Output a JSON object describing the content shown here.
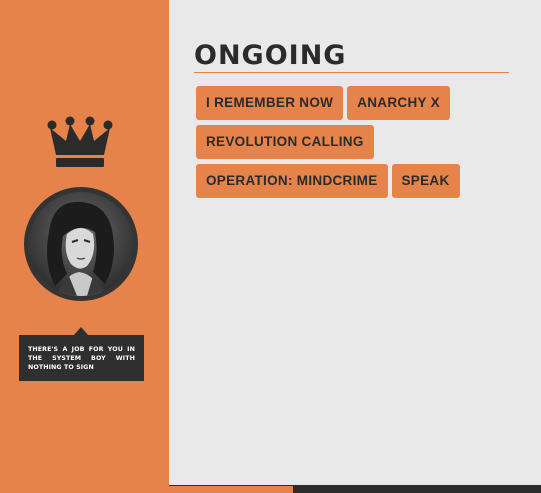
{
  "header": {
    "title": "ongoing"
  },
  "sidebar": {
    "quote": "There's a job for you in the system boy with nothing to sign"
  },
  "tags": [
    {
      "label": "I Remember Now"
    },
    {
      "label": "Anarchy X"
    },
    {
      "label": "Revolution Calling"
    },
    {
      "label": "Operation: Mindcrime"
    },
    {
      "label": "Speak"
    }
  ],
  "colors": {
    "accent": "#e6834b",
    "dark": "#2b2b2b",
    "background": "#e9e9e9"
  },
  "icons": {
    "logo": "crown-icon",
    "profile": "avatar"
  }
}
